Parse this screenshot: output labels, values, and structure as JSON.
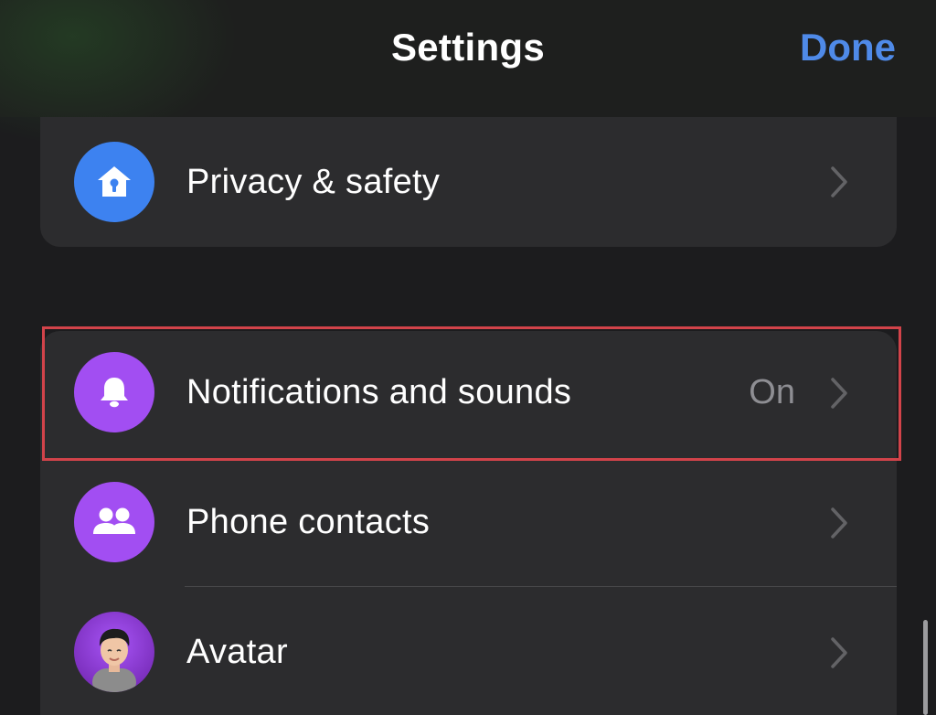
{
  "header": {
    "title": "Settings",
    "done_label": "Done"
  },
  "rows": {
    "privacy": {
      "label": "Privacy & safety",
      "icon": "house-lock-icon",
      "icon_color": "#3d82f0"
    },
    "notifications": {
      "label": "Notifications and sounds",
      "value": "On",
      "icon": "bell-icon",
      "icon_color": "#a24ef2"
    },
    "contacts": {
      "label": "Phone contacts",
      "icon": "people-icon",
      "icon_color": "#a24ef2"
    },
    "avatar": {
      "label": "Avatar",
      "icon": "avatar-image",
      "icon_color": "#8a3fd6"
    }
  },
  "colors": {
    "accent": "#4f8ae8",
    "highlight_border": "#d2434a",
    "background": "#1c1c1e",
    "cell": "#2c2c2e"
  }
}
